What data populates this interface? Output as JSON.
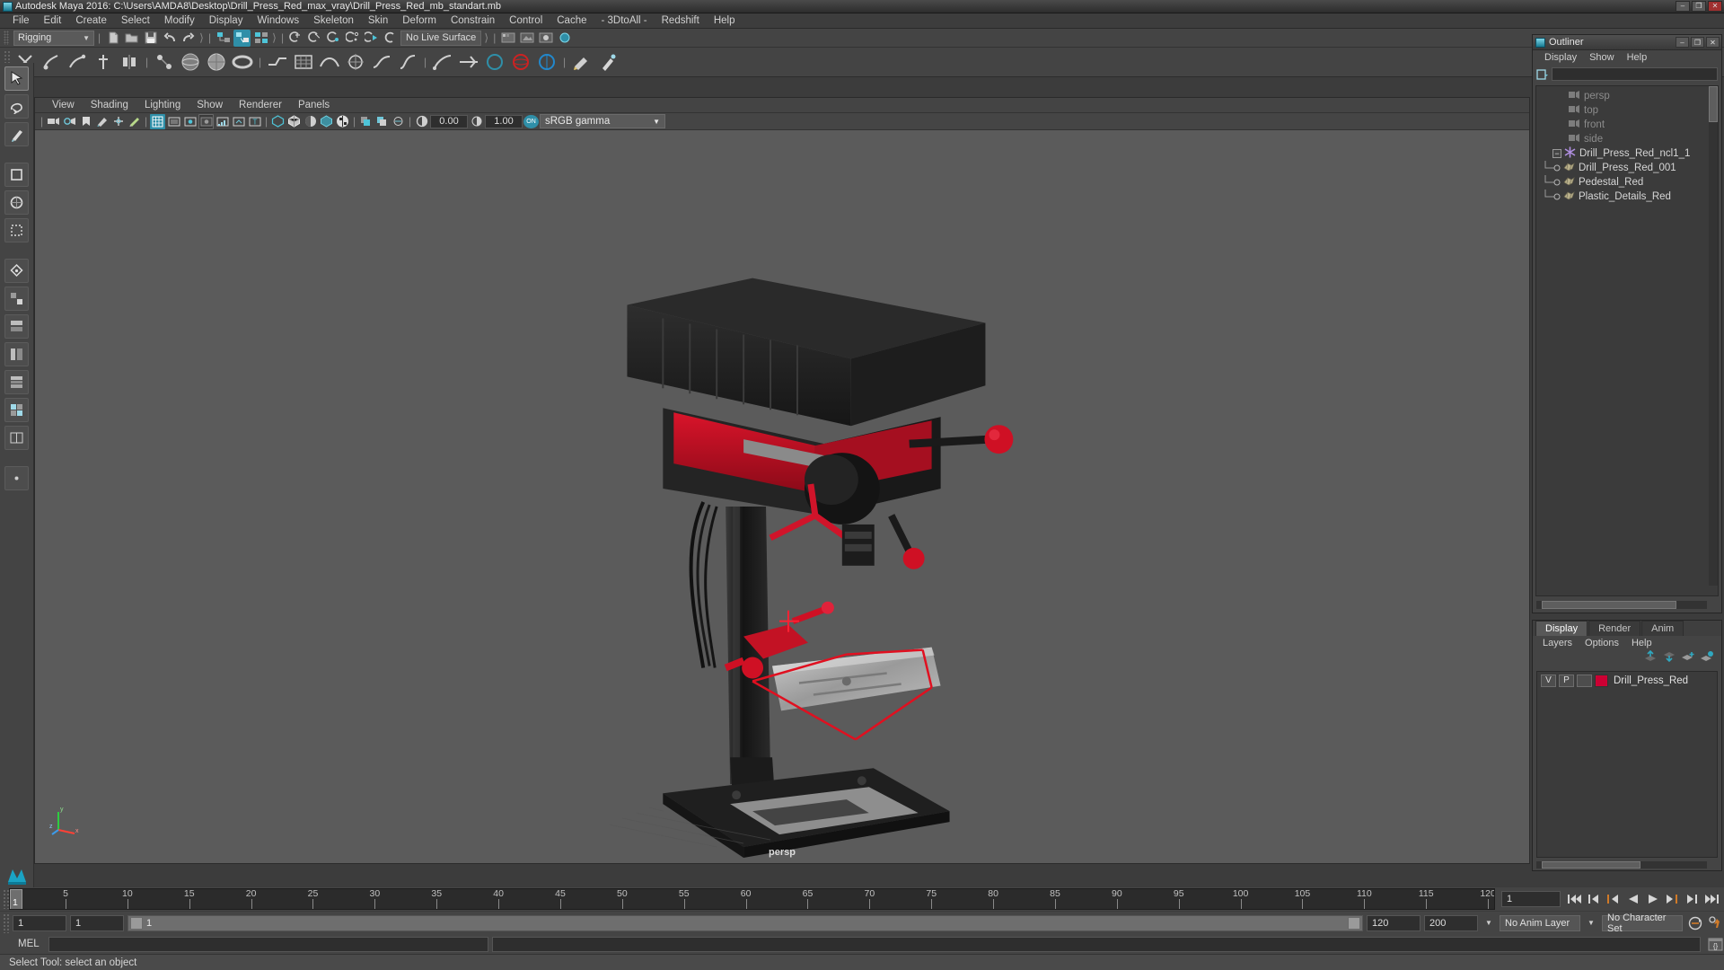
{
  "window": {
    "title": "Autodesk Maya 2016: C:\\Users\\AMDA8\\Desktop\\Drill_Press_Red_max_vray\\Drill_Press_Red_mb_standart.mb",
    "minimize": "–",
    "maximize": "❐",
    "close": "✕"
  },
  "menubar": {
    "items": [
      {
        "label": "File"
      },
      {
        "label": "Edit"
      },
      {
        "label": "Create"
      },
      {
        "label": "Select"
      },
      {
        "label": "Modify"
      },
      {
        "label": "Display"
      },
      {
        "label": "Windows"
      },
      {
        "label": "Skeleton"
      },
      {
        "label": "Skin"
      },
      {
        "label": "Deform"
      },
      {
        "label": "Constrain"
      },
      {
        "label": "Control"
      },
      {
        "label": "Cache"
      },
      {
        "label": "- 3DtoAll -"
      },
      {
        "label": "Redshift"
      },
      {
        "label": "Help"
      }
    ]
  },
  "statusline": {
    "menuset": "Rigging",
    "live_surface": "No Live Surface"
  },
  "viewport": {
    "menus": [
      {
        "label": "View"
      },
      {
        "label": "Shading"
      },
      {
        "label": "Lighting"
      },
      {
        "label": "Show"
      },
      {
        "label": "Renderer"
      },
      {
        "label": "Panels"
      }
    ],
    "exposure": "0.00",
    "gamma": "1.00",
    "on_toggle": "ON",
    "color_profile": "sRGB gamma",
    "camera_label": "persp",
    "axis": {
      "x": "x",
      "y": "y",
      "z": "z"
    }
  },
  "outliner": {
    "title": "Outliner",
    "minimize": "–",
    "maximize": "❐",
    "close": "✕",
    "menus": [
      {
        "label": "Display"
      },
      {
        "label": "Show"
      },
      {
        "label": "Help"
      }
    ],
    "search_value": "",
    "search_placeholder": "",
    "tree": [
      {
        "label": "persp",
        "type": "camera",
        "dim": true,
        "depth": 1
      },
      {
        "label": "top",
        "type": "camera",
        "dim": true,
        "depth": 1
      },
      {
        "label": "front",
        "type": "camera",
        "dim": true,
        "depth": 1
      },
      {
        "label": "side",
        "type": "camera",
        "dim": true,
        "depth": 1
      },
      {
        "label": "Drill_Press_Red_ncl1_1",
        "type": "group",
        "dim": false,
        "depth": 0,
        "expanded": true
      },
      {
        "label": "Drill_Press_Red_001",
        "type": "mesh",
        "dim": false,
        "depth": 2
      },
      {
        "label": "Pedestal_Red",
        "type": "mesh",
        "dim": false,
        "depth": 2
      },
      {
        "label": "Plastic_Details_Red",
        "type": "mesh",
        "dim": false,
        "depth": 2
      }
    ]
  },
  "layer_editor": {
    "tabs": [
      {
        "label": "Display",
        "active": true
      },
      {
        "label": "Render",
        "active": false
      },
      {
        "label": "Anim",
        "active": false
      }
    ],
    "menus": [
      {
        "label": "Layers"
      },
      {
        "label": "Options"
      },
      {
        "label": "Help"
      }
    ],
    "layers": [
      {
        "visibility": "V",
        "playback": "P",
        "shading": "",
        "color": "#cc0033",
        "name": "Drill_Press_Red"
      }
    ]
  },
  "timeslider": {
    "start": 1,
    "end": 120,
    "current_frame": "1",
    "frame_field": "1",
    "tick_step": 5,
    "labels": [
      5,
      10,
      15,
      20,
      25,
      30,
      35,
      40,
      45,
      50,
      55,
      60,
      65,
      70,
      75,
      80,
      85,
      90,
      95,
      100,
      105,
      110,
      115,
      120
    ]
  },
  "rangeslider": {
    "range_start": "1",
    "range_start_2": "1",
    "bar_label": "1",
    "range_end": "120",
    "range_end_2": "200",
    "anim_layer": "No Anim Layer",
    "character_set": "No Character Set"
  },
  "commandline": {
    "label": "MEL",
    "input_value": "",
    "output_value": ""
  },
  "helpline": {
    "text": "Select Tool: select an object"
  },
  "colors": {
    "accent": "#2f8fa8",
    "layer_red": "#cc0033",
    "panel_bg": "#444444",
    "viewport_bg": "#5b5b5b",
    "orange": "#d07a28"
  }
}
